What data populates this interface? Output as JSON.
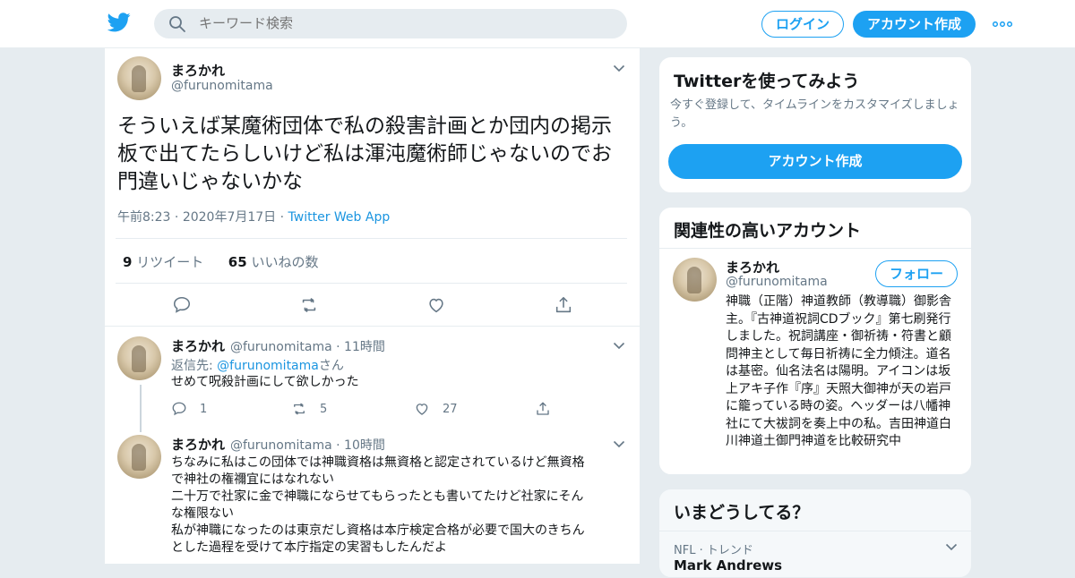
{
  "header": {
    "search_placeholder": "キーワード検索",
    "login_label": "ログイン",
    "signup_label": "アカウント作成"
  },
  "tweet": {
    "name": "まろかれ",
    "handle": "@furunomitama",
    "text": "そういえば某魔術団体で私の殺害計画とか団内の掲示板で出てたらしいけど私は渾沌魔術師じゃないのでお門違いじゃないかな",
    "time": "午前8:23",
    "date": "2020年7月17日",
    "source": "Twitter Web App",
    "retweet_count": "9",
    "retweet_label": "リツイート",
    "like_count": "65",
    "like_label": "いいねの数"
  },
  "replies": [
    {
      "name": "まろかれ",
      "handle": "@furunomitama",
      "time": "11時間",
      "reply_to_prefix": "返信先: ",
      "reply_to_handle": "@furunomitama",
      "reply_to_suffix": "さん",
      "text": "せめて呪殺計画にして欲しかった",
      "reply_count": "1",
      "retweet_count": "5",
      "like_count": "27"
    },
    {
      "name": "まろかれ",
      "handle": "@furunomitama",
      "time": "10時間",
      "text_lines": [
        "ちなみに私はこの団体では神職資格は無資格と認定されているけど無資格",
        "で神社の権禰宜にはなれない",
        "二十万で社家に金で神職にならせてもらったとも書いてたけど社家にそん",
        "な権限ない",
        "私が神職になったのは東京だし資格は本庁検定合格が必要で国大のきちん",
        "とした過程を受けて本庁指定の実習もしたんだよ"
      ]
    }
  ],
  "sidebar": {
    "signup_card": {
      "title": "Twitterを使ってみよう",
      "subtitle": "今すぐ登録して、タイムラインをカスタマイズしましょう。",
      "button": "アカウント作成"
    },
    "related_card": {
      "title": "関連性の高いアカウント",
      "name": "まろかれ",
      "handle": "@furunomitama",
      "follow_label": "フォロー",
      "bio": "神職（正階）神道教師（教導職）御影舎主。『古神道祝詞CDブック』第七刷発行しました。祝詞講座・御祈祷・符書と顧問神主として毎日祈祷に全力傾注。道名は基密。仙名法名は陽明。アイコンは坂上アキ子作『序』天照大御神が天の岩戸に籠っている時の姿。ヘッダーは八幡神社にて大祓詞を奏上中の私。吉田神道白川神道土御門神道を比較研究中"
    },
    "trends_card": {
      "title": "いまどうしてる？",
      "trend_meta": "NFL · トレンド",
      "trend_name": "Mark Andrews"
    }
  }
}
